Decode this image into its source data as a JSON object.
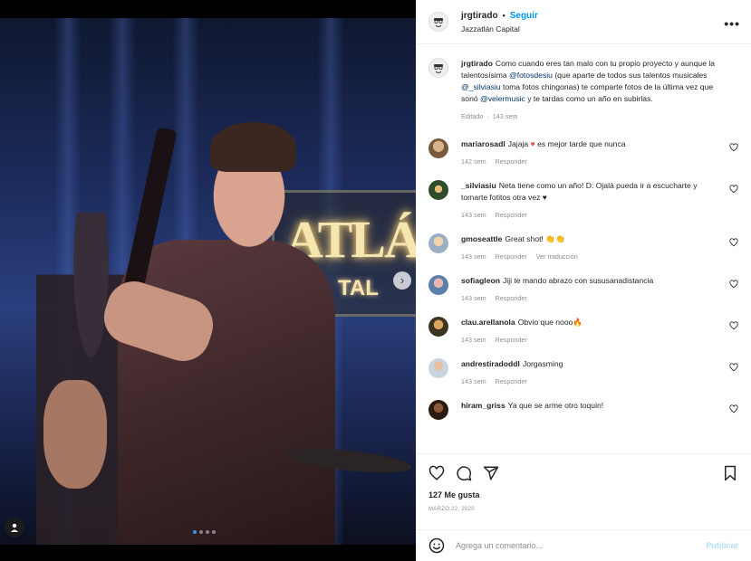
{
  "colors": {
    "accent": "#0095f6",
    "heart": "#ed4956",
    "muted": "#8e8e8e",
    "link": "#00376b"
  },
  "media": {
    "sign_big": "ATLÁ",
    "sign_small": "TAL",
    "carousel_dots": 4,
    "active_dot": 0
  },
  "header": {
    "username": "jrgtirado",
    "separator": "•",
    "follow_label": "Seguir",
    "location": "Jazzatlán Capital",
    "more_label": "•••"
  },
  "caption": {
    "username": "jrgtirado",
    "t1": "Como cuando eres tan malo con tu propio proyecto y aunque la talentosísima ",
    "m1": "@fotosdesiu",
    "t2": " (que aparte de todos sus talentos musicales ",
    "m2": "@_silviasiu",
    "t3": " toma fotos chingonas) te comparte fotos de la última vez que sonó ",
    "m3": "@velermusic",
    "t4": " y te tardas como un año en subirlas.",
    "edited": "Editado",
    "sep": "·",
    "time": "143 sem"
  },
  "comments": [
    {
      "username": "mariarosadl",
      "text": "Jajaja ",
      "emoji": "♥",
      "text_after": " es mejor tarde que nunca",
      "time": "142 sem",
      "reply": "Responder",
      "translate": ""
    },
    {
      "username": "_silviasiu",
      "text": "Neta tiene como un año! D: Ojalá pueda ir a escucharte y tomarte fotitos otra vez ",
      "emoji": "♥",
      "text_after": "",
      "time": "143 sem",
      "reply": "Responder",
      "translate": ""
    },
    {
      "username": "gmoseattle",
      "text": "Great shot! ",
      "emoji": "👏👏",
      "text_after": "",
      "time": "143 sem",
      "reply": "Responder",
      "translate": "Ver traducción"
    },
    {
      "username": "sofiagleon",
      "text": "Jiji te mando abrazo con sususanadistancia",
      "emoji": "",
      "text_after": "",
      "time": "143 sem",
      "reply": "Responder",
      "translate": ""
    },
    {
      "username": "clau.arellanola",
      "text": "Obvio que nooo",
      "emoji": "🔥",
      "text_after": "",
      "time": "143 sem",
      "reply": "Responder",
      "translate": ""
    },
    {
      "username": "andrestiradoddl",
      "text": "Jorgasming",
      "emoji": "",
      "text_after": "",
      "time": "143 sem",
      "reply": "Responder",
      "translate": ""
    },
    {
      "username": "hiram_griss",
      "text": "Ya que se arme otro toquin!",
      "emoji": "",
      "text_after": "",
      "time": "",
      "reply": "",
      "translate": ""
    }
  ],
  "actions": {
    "likes": "127 Me gusta",
    "date": "MARZO 22, 2020"
  },
  "add_comment": {
    "placeholder": "Agrega un comentario...",
    "post_label": "Publicar"
  }
}
